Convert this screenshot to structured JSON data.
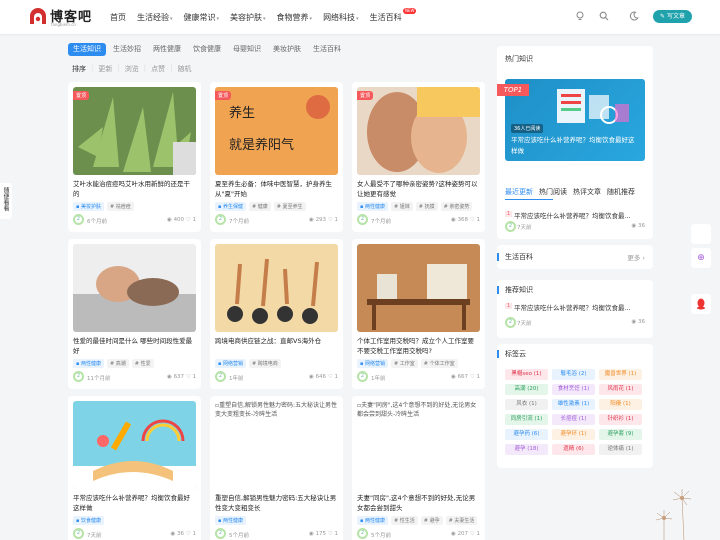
{
  "header": {
    "logo_text": "博客吧",
    "logo_sub": "fangbiem.cn",
    "nav": [
      {
        "label": "首页",
        "dropdown": false
      },
      {
        "label": "生活经验",
        "dropdown": true
      },
      {
        "label": "健康常识",
        "dropdown": true
      },
      {
        "label": "美容护肤",
        "dropdown": true
      },
      {
        "label": "食物营养",
        "dropdown": true
      },
      {
        "label": "网络科技",
        "dropdown": true
      },
      {
        "label": "生活百科",
        "dropdown": false
      }
    ],
    "new_badge": "NEW",
    "write_label": "写文章",
    "icons": [
      "bulb-icon",
      "search-icon",
      "moon-icon"
    ]
  },
  "left_tab": "随便看看",
  "tabs": [
    "生活知识",
    "生活妙招",
    "两性健康",
    "饮食健康",
    "母婴知识",
    "美妆护肤",
    "生活百科"
  ],
  "sort": {
    "label": "排序",
    "options": [
      "更新",
      "浏览",
      "点赞",
      "随机"
    ]
  },
  "posts": [
    {
      "title": "艾叶水能治痘痘吗艾叶水用新鲜的还是干的",
      "category": "美妆护肤",
      "tags": [
        "祛痘痘"
      ],
      "time": "6个月前",
      "views": "400",
      "likes": "1",
      "top": "置顶"
    },
    {
      "title": "夏至养生必备：体味中医智慧，护身养生从\"夏\"开始",
      "category": "养生保健",
      "tags": [
        "健康",
        "夏至养生"
      ],
      "time": "7个月前",
      "views": "293",
      "likes": "1",
      "top": "置顶",
      "img_text": "养生 就是养阳气"
    },
    {
      "title": "女人最受不了哪种亲密姿势?这种姿势可以让她更有感觉",
      "category": "两性健康",
      "tags": [
        "姐妹",
        "抚摸",
        "亲密姿势"
      ],
      "time": "7个月前",
      "views": "368",
      "likes": "1",
      "top": "置顶"
    },
    {
      "title": "性爱的最佳时间是什么 哪些时间段性爱最好",
      "category": "两性健康",
      "tags": [
        "高潮",
        "性爱"
      ],
      "time": "11个月前",
      "views": "637",
      "likes": "1"
    },
    {
      "title": "跨境电商供应链之战：直邮VS海外仓",
      "category": "网络营销",
      "tags": [
        "跨境电商"
      ],
      "time": "1年前",
      "views": "646",
      "likes": "1"
    },
    {
      "title": "个体工作室用交税吗？成立个人工作室要不要交税工作室用交税吗?",
      "category": "网络营销",
      "tags": [
        "工作室",
        "个体工作室"
      ],
      "time": "1年前",
      "views": "667",
      "likes": "1"
    },
    {
      "title": "平常应该吃什么补营养呢？均衡饮食最好这样做",
      "category": "饮食健康",
      "tags": [],
      "time": "7天前",
      "views": "36",
      "likes": "1"
    },
    {
      "title": "重塑自信,解锁男性魅力密码:五大秘诀让男性变大变粗变长",
      "category": "两性健康",
      "tags": [],
      "time": "5个月前",
      "views": "175",
      "likes": "1",
      "img_alt": "重塑自信,解锁男性魅力密码:五大秘诀让男性变大变粗变长-冷眸生活"
    },
    {
      "title": "夫妻\"同房\",这4个意想不到的好处,无论男女都会尝到甜头",
      "category": "两性健康",
      "tags": [
        "性生活",
        "避孕",
        "夫妻生活"
      ],
      "time": "5个月前",
      "views": "207",
      "likes": "1",
      "img_alt": "夫妻\"同房\",这4个意想不到的好处,无论男女都会尝到甜头-冷眸生活"
    }
  ],
  "sidebar": {
    "hot_title": "热门知识",
    "hot_ribbon": "TOP1",
    "hot_caption": "平常应该吃什么补营养呢？均衡饮食最好这样做",
    "hot_label": "36人已阅读",
    "list_tabs": [
      "最近更新",
      "热门阅读",
      "热评文章",
      "随机推荐"
    ],
    "recent": {
      "title": "平常应该吃什么补营养呢？均衡饮食最...",
      "time": "7天前",
      "views": "36"
    },
    "baike_title": "生活百科",
    "more": "更多",
    "recommend_title": "推荐知识",
    "recommend": {
      "title": "平常应该吃什么补营养呢？均衡饮食最...",
      "time": "7天前",
      "views": "36"
    },
    "cloud_title": "标签云",
    "cloud": [
      {
        "label": "黑帽seo (1)",
        "color": "#e0334c",
        "bg": "#fde7ea"
      },
      {
        "label": "鬈毛浴 (2)",
        "color": "#2d8cf0",
        "bg": "#e8f3fe"
      },
      {
        "label": "魔兽世界 (1)",
        "color": "#f08a24",
        "bg": "#fdf1e4"
      },
      {
        "label": "高潮 (20)",
        "color": "#2fa05f",
        "bg": "#e4f6ea"
      },
      {
        "label": "食材烹饪 (1)",
        "color": "#a35bd6",
        "bg": "#f3e9fb"
      },
      {
        "label": "风雨花 (1)",
        "color": "#e0334c",
        "bg": "#fde7ea"
      },
      {
        "label": "风衣 (1)",
        "color": "#777",
        "bg": "#f1f1f1"
      },
      {
        "label": "雄性激素 (1)",
        "color": "#2d8cf0",
        "bg": "#e8f3fe"
      },
      {
        "label": "阳痿 (1)",
        "color": "#f08a24",
        "bg": "#fdf1e4"
      },
      {
        "label": "同房引流 (1)",
        "color": "#2fa05f",
        "bg": "#e4f6ea"
      },
      {
        "label": "长痘痘 (1)",
        "color": "#a35bd6",
        "bg": "#f3e9fb"
      },
      {
        "label": "针织衫 (1)",
        "color": "#e0334c",
        "bg": "#fde7ea"
      },
      {
        "label": "避孕药 (6)",
        "color": "#2d8cf0",
        "bg": "#e8f3fe"
      },
      {
        "label": "避孕环 (1)",
        "color": "#f08a24",
        "bg": "#fdf1e4"
      },
      {
        "label": "避孕套 (9)",
        "color": "#2fa05f",
        "bg": "#e4f6ea"
      },
      {
        "label": "避孕 (18)",
        "color": "#a35bd6",
        "bg": "#f3e9fb"
      },
      {
        "label": "遗精 (6)",
        "color": "#e0334c",
        "bg": "#fde7ea"
      },
      {
        "label": "逆体痛 (1)",
        "color": "#777",
        "bg": "#f1f1f1"
      }
    ]
  },
  "float_icons": [
    "plus-icon",
    "qq-icon"
  ]
}
